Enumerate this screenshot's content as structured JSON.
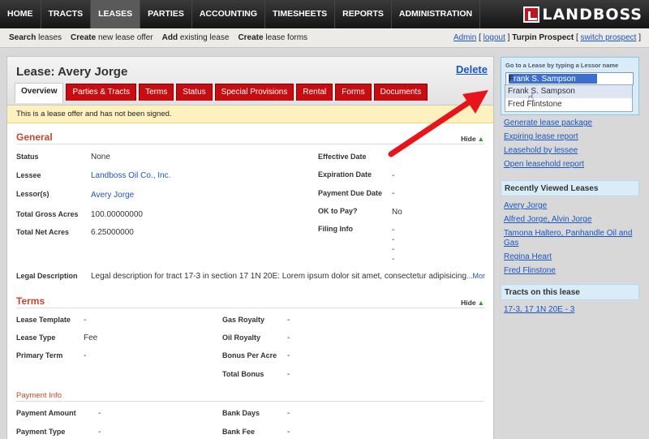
{
  "topnav": {
    "items": [
      "HOME",
      "TRACTS",
      "LEASES",
      "PARTIES",
      "ACCOUNTING",
      "TIMESHEETS",
      "REPORTS",
      "ADMINISTRATION"
    ],
    "active": "LEASES",
    "logo": "LANDBOSS"
  },
  "subnav": {
    "items": [
      {
        "bold": "Search",
        "rest": " leases"
      },
      {
        "bold": "Create",
        "rest": " new lease offer"
      },
      {
        "bold": "Add",
        "rest": " existing lease"
      },
      {
        "bold": "Create",
        "rest": " lease forms"
      }
    ],
    "user": "Admin",
    "logout": "logout",
    "project": "Turpin Prospect",
    "switch": "switch prospect"
  },
  "lease": {
    "title": "Lease: Avery Jorge",
    "delete": "Delete",
    "tabs": [
      "Overview",
      "Parties & Tracts",
      "Terms",
      "Status",
      "Special Provisions",
      "Rental",
      "Forms",
      "Documents"
    ],
    "active_tab": "Overview",
    "notice": "This is a lease offer and has not been signed."
  },
  "general": {
    "title": "General",
    "hide": "Hide",
    "left": [
      {
        "label": "Status",
        "value": "None",
        "link": false
      },
      {
        "label": "Lessee",
        "value": "Landboss Oil Co., Inc.",
        "link": true
      },
      {
        "label": "Lessor(s)",
        "value": "Avery Jorge",
        "link": true
      },
      {
        "label": "Total Gross Acres",
        "value": "100.00000000",
        "link": false
      },
      {
        "label": "Total Net Acres",
        "value": "6.25000000",
        "link": false
      }
    ],
    "right": [
      {
        "label": "Effective Date",
        "value": ""
      },
      {
        "label": "Expiration Date",
        "value": "-"
      },
      {
        "label": "Payment Due Date",
        "value": "-"
      },
      {
        "label": "OK to Pay?",
        "value": "No"
      },
      {
        "label": "Filing Info",
        "value": "-"
      }
    ],
    "filing_extra": [
      "-",
      "-",
      "-"
    ],
    "legal_label": "Legal Description",
    "legal_value": "Legal description for tract 17-3 in section 17 1N 20E: Lorem ipsum dolor sit amet, consectetur adipisicing",
    "legal_more": "...More"
  },
  "terms": {
    "title": "Terms",
    "hide": "Hide",
    "left": [
      {
        "label": "Lease Template",
        "value": "-"
      },
      {
        "label": "Lease Type",
        "value": "Fee"
      },
      {
        "label": "Primary Term",
        "value": "-"
      }
    ],
    "right": [
      {
        "label": "Gas Royalty",
        "value": "-"
      },
      {
        "label": "Oil Royalty",
        "value": "-"
      },
      {
        "label": "Bonus Per Acre",
        "value": "-"
      },
      {
        "label": "Total Bonus",
        "value": "-"
      }
    ],
    "payment_title": "Payment Info",
    "payment_left": [
      {
        "label": "Payment Amount",
        "value": "-"
      },
      {
        "label": "Payment Type",
        "value": "-"
      }
    ],
    "payment_right": [
      {
        "label": "Bank Days",
        "value": "-"
      },
      {
        "label": "Bank Fee",
        "value": "-"
      }
    ]
  },
  "goto": {
    "label": "Go to a Lease by typing a Lessor name",
    "input_first": "F",
    "input_selected": "rank S. Sampson",
    "suggestions": [
      "Frank S. Sampson",
      "Fred Flintstone"
    ]
  },
  "quick_links": [
    "Generate lease package",
    "Expiring lease report",
    "Leasehold by lessee",
    "Open leasehold report"
  ],
  "recent": {
    "title": "Recently Viewed Leases",
    "items": [
      "Avery Jorge",
      "Alfred Jorge, Alvin Jorge",
      "Tamona Haltero, Panhandle Oil and Gas",
      "Regina Heart",
      "Fred Flinstone"
    ]
  },
  "tracts": {
    "title": "Tracts on this lease",
    "items": [
      "17-3, 17 1N 20E - 3"
    ]
  },
  "colors": {
    "nav_dark": "#1c1c1c",
    "tab_red": "#c70d12",
    "link_blue": "#1a56c4",
    "section_orange": "#c8452c",
    "notice_yellow": "#fdf1bf",
    "sidebar_blue": "#d9ecf7",
    "arrow_red": "#e8141b"
  }
}
